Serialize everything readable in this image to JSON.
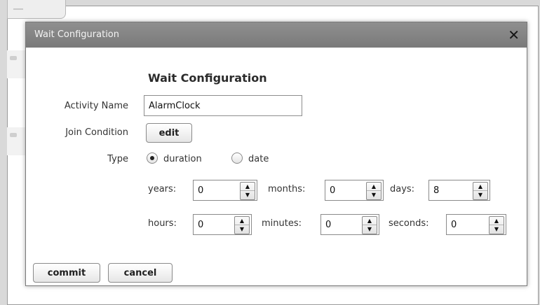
{
  "dialog": {
    "title": "Wait Configuration",
    "heading": "Wait Configuration",
    "close_icon": "close-icon"
  },
  "form": {
    "activity_name_label": "Activity Name",
    "activity_name_value": "AlarmClock",
    "join_condition_label": "Join Condition",
    "edit_label": "edit",
    "type_label": "Type",
    "type_options": [
      "duration",
      "date"
    ],
    "type_selected": "duration"
  },
  "duration": {
    "years": {
      "label": "years:",
      "value": "0"
    },
    "months": {
      "label": "months:",
      "value": "0"
    },
    "days": {
      "label": "days:",
      "value": "8"
    },
    "hours": {
      "label": "hours:",
      "value": "0"
    },
    "minutes": {
      "label": "minutes:",
      "value": "0"
    },
    "seconds": {
      "label": "seconds:",
      "value": "0"
    }
  },
  "actions": {
    "commit_label": "commit",
    "cancel_label": "cancel"
  },
  "colors": {
    "titlebar": "#868686",
    "title_text": "#f4f4f4",
    "background": "#d9d9d9"
  }
}
